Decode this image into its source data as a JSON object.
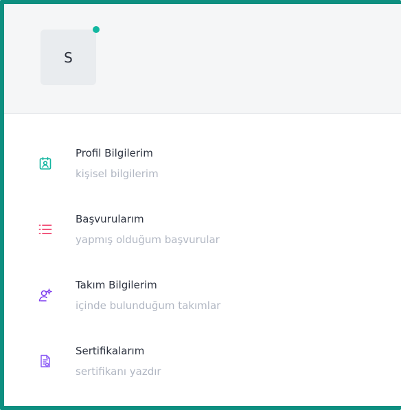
{
  "profile": {
    "avatar_initial": "S",
    "status_color": "#12b7a0"
  },
  "menu": {
    "items": [
      {
        "title": "Profil Bilgilerim",
        "subtitle": "kişisel bilgilerim",
        "icon": "profile-card-icon",
        "color": "#13b5a0"
      },
      {
        "title": "Başvurularım",
        "subtitle": "yapmış olduğum başvurular",
        "icon": "list-icon",
        "color": "#f0416c"
      },
      {
        "title": "Takım Bilgilerim",
        "subtitle": "içinde bulunduğum takımlar",
        "icon": "team-settings-icon",
        "color": "#7c3aed"
      },
      {
        "title": "Sertifikalarım",
        "subtitle": "sertifikanı yazdır",
        "icon": "certificate-icon",
        "color": "#8b5cf6"
      }
    ]
  }
}
